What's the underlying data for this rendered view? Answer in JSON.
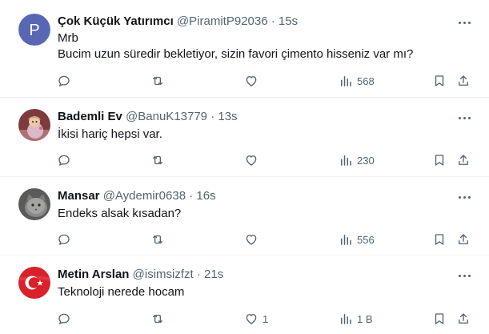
{
  "tweets": [
    {
      "name": "Çok Küçük Yatırımcı",
      "handle": "@PiramitP92036",
      "sep": "·",
      "time": "15s",
      "avatar_letter": "P",
      "avatar_color": "#5867b4",
      "text_lines": [
        "Mrb",
        "Bucim uzun süredir bekletiyor, sizin favori çimento hisseniz var mı?"
      ],
      "views": "568"
    },
    {
      "name": "Bademli Ev",
      "handle": "@BanuK13779",
      "sep": "·",
      "time": "13s",
      "avatar_icon": "doll-photo-icon",
      "text_lines": [
        "İkisi hariç hepsi var."
      ],
      "views": "230"
    },
    {
      "name": "Mansar",
      "handle": "@Aydemir0638",
      "sep": "·",
      "time": "16s",
      "avatar_icon": "cat-photo-icon",
      "text_lines": [
        "Endeks alsak kısadan?"
      ],
      "views": "556"
    },
    {
      "name": "Metin Arslan",
      "handle": "@isimsizfzt",
      "sep": "·",
      "time": "21s",
      "avatar_icon": "turkish-flag-icon",
      "text_lines": [
        "Teknoloji nerede hocam"
      ],
      "likes": "1",
      "views": "1 B"
    }
  ],
  "icons": {
    "reply": "reply-icon",
    "retweet": "retweet-icon",
    "like": "heart-icon",
    "views": "views-icon",
    "bookmark": "bookmark-icon",
    "share": "share-icon",
    "more": "more-icon"
  },
  "colors": {
    "text": "#0f1419",
    "secondary": "#536471",
    "divider": "#eff3f4"
  }
}
